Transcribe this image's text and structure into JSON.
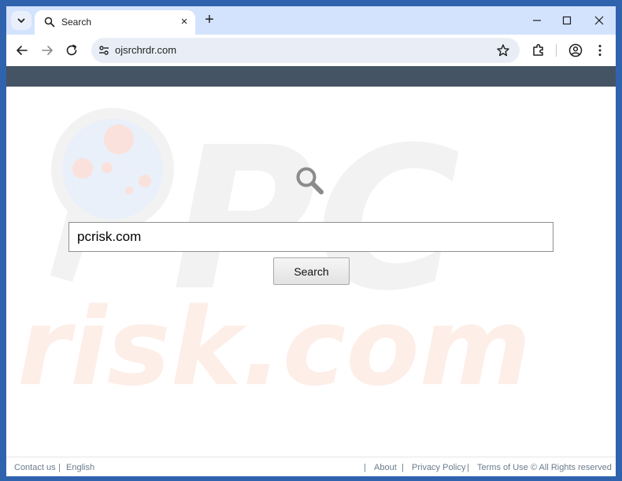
{
  "browser": {
    "tab": {
      "title": "Search"
    },
    "new_tab_symbol": "+",
    "close_tab_symbol": "×",
    "address_bar": {
      "url": "ojsrchrdr.com"
    }
  },
  "page": {
    "search_input": {
      "value": "pcrisk.com"
    },
    "search_button_label": "Search",
    "watermark": {
      "top_text": "PC",
      "bottom_text": "risk.com"
    },
    "footer": {
      "contact": "Contact us",
      "sep1": "|",
      "language": "English",
      "sep2": "|",
      "about": "About",
      "sep3": "|",
      "privacy": "Privacy Policy",
      "sep4": "|",
      "terms": "Terms of Use",
      "copyright": "© All Rights reserved"
    }
  },
  "colors": {
    "desktop_bg": "#2f63ae",
    "tabstrip_bg": "#d3e3fd",
    "page_header_bar": "#455464",
    "footer_text": "#6b7c8c"
  },
  "icons": {
    "tab_search": "chevron-down-icon",
    "tab_favicon": "search-icon",
    "back": "arrow-left-icon",
    "forward": "arrow-right-icon",
    "reload": "reload-icon",
    "site_info": "tune-icon",
    "bookmark": "star-icon",
    "extensions": "puzzle-icon",
    "profile": "account-icon",
    "menu": "kebab-menu-icon",
    "minimize": "minimize-icon",
    "maximize": "maximize-icon",
    "close": "close-icon"
  }
}
